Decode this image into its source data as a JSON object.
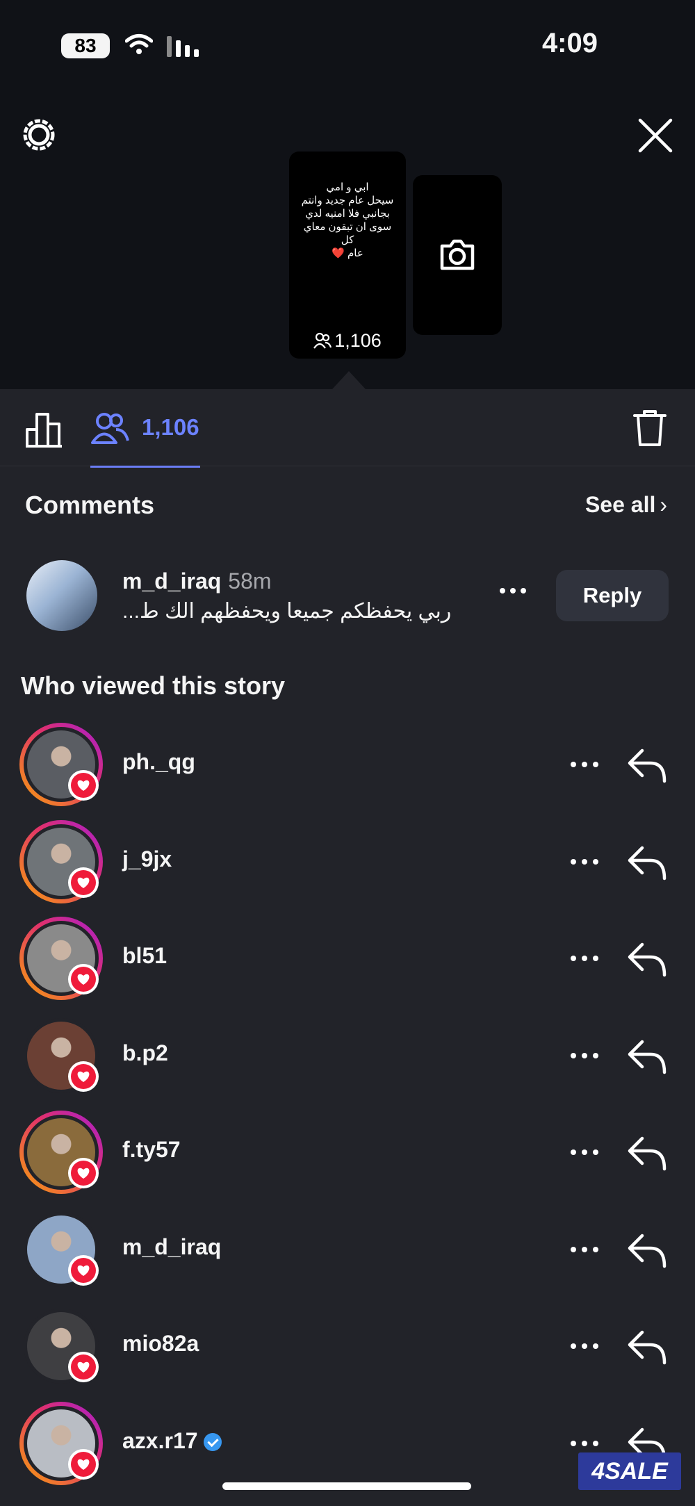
{
  "status_bar": {
    "battery": "83",
    "time": "4:09"
  },
  "story": {
    "text": "ابي و امي\nسيحل عام جديد وانتم\nبجانبي فلا امنيه لدي\nسوى ان تبقون معاي كل\nعام ❤️",
    "viewer_count": "1,106"
  },
  "tabs": {
    "viewers_count": "1,106"
  },
  "comments": {
    "title": "Comments",
    "see_all": "See all",
    "items": [
      {
        "username": "m_d_iraq",
        "time": "58m",
        "text": "ربي يحفظكم جميعا ويحفظهم الك ط...",
        "reply_label": "Reply"
      }
    ]
  },
  "viewers": {
    "title": "Who viewed this story",
    "items": [
      {
        "username": "ph._qg",
        "ring": true,
        "avatar_color": "#5a5d63"
      },
      {
        "username": "j_9jx",
        "ring": true,
        "avatar_color": "#6f7478"
      },
      {
        "username": "bl51",
        "ring": true,
        "avatar_color": "#8a8a8a"
      },
      {
        "username": "b.p2",
        "ring": false,
        "avatar_color": "#6b4034"
      },
      {
        "username": "f.ty57",
        "ring": true,
        "avatar_color": "#8a6b3c"
      },
      {
        "username": "m_d_iraq",
        "ring": false,
        "avatar_color": "#8ea6c6"
      },
      {
        "username": "mio82a",
        "ring": false,
        "avatar_color": "#3f3f42"
      },
      {
        "username": "azx.r17",
        "ring": true,
        "verified": true,
        "avatar_color": "#b9bdc4"
      }
    ]
  },
  "watermark": "4SALE",
  "colors": {
    "accent": "#6c82ff",
    "heart": "#ef1b3a",
    "verified": "#3797f0"
  }
}
